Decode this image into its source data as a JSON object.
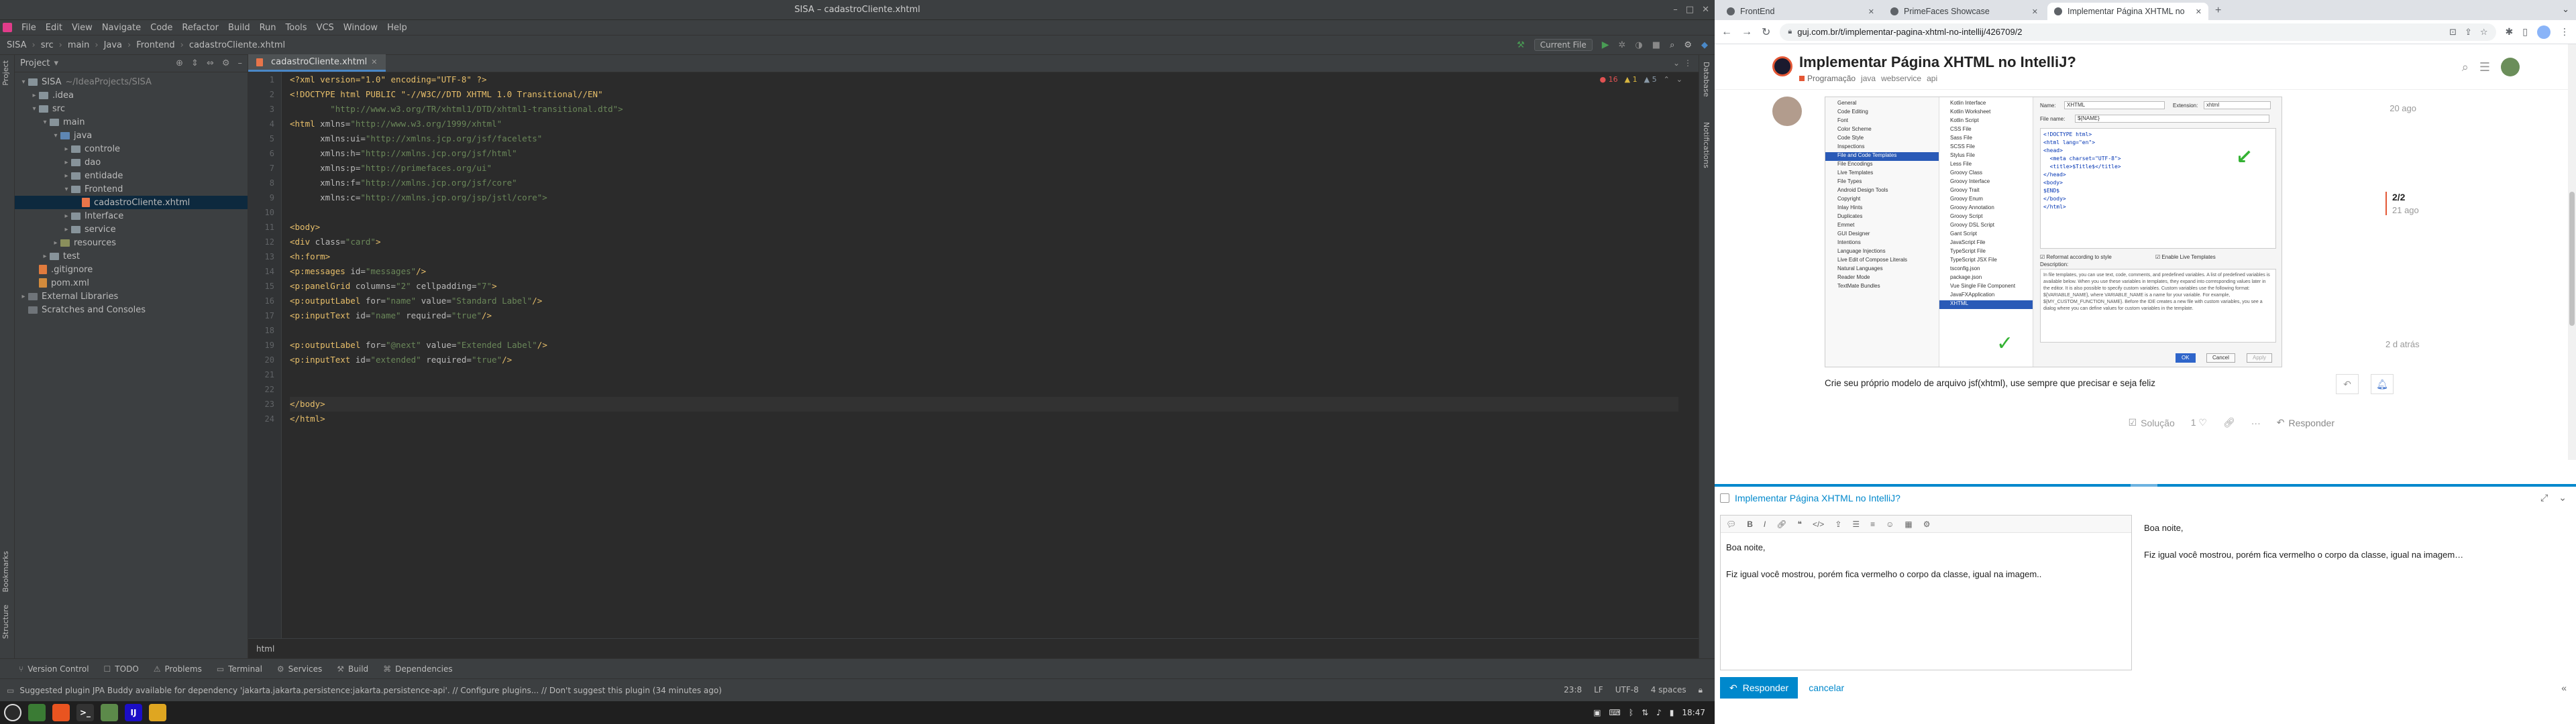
{
  "ide": {
    "window_title": "SISA – cadastroCliente.xhtml",
    "menu": [
      "File",
      "Edit",
      "View",
      "Navigate",
      "Code",
      "Refactor",
      "Build",
      "Run",
      "Tools",
      "VCS",
      "Window",
      "Help"
    ],
    "breadcrumb": [
      "SISA",
      "src",
      "main",
      "Java",
      "Frontend",
      "cadastroCliente.xhtml"
    ],
    "run_config": "Current File",
    "left_tabs": [
      "Project",
      "Bookmarks",
      "Structure"
    ],
    "right_tabs": [
      "Database",
      "Notifications"
    ],
    "project": {
      "title": "Project",
      "tree": [
        {
          "label": "SISA",
          "extra": "~/IdeaProjects/SISA",
          "depth": 0,
          "type": "folder",
          "open": true
        },
        {
          "label": ".idea",
          "depth": 1,
          "type": "folder",
          "open": false
        },
        {
          "label": "src",
          "depth": 1,
          "type": "folder",
          "open": true
        },
        {
          "label": "main",
          "depth": 2,
          "type": "folder",
          "open": true
        },
        {
          "label": "java",
          "depth": 3,
          "type": "src",
          "open": true
        },
        {
          "label": "controle",
          "depth": 4,
          "type": "folder",
          "open": false
        },
        {
          "label": "dao",
          "depth": 4,
          "type": "folder",
          "open": false
        },
        {
          "label": "entidade",
          "depth": 4,
          "type": "folder",
          "open": false
        },
        {
          "label": "Frontend",
          "depth": 4,
          "type": "folder",
          "open": true
        },
        {
          "label": "cadastroCliente.xhtml",
          "depth": 5,
          "type": "file",
          "selected": true
        },
        {
          "label": "Interface",
          "depth": 4,
          "type": "folder",
          "open": false
        },
        {
          "label": "service",
          "depth": 4,
          "type": "folder",
          "open": false
        },
        {
          "label": "resources",
          "depth": 3,
          "type": "res",
          "open": false
        },
        {
          "label": "test",
          "depth": 2,
          "type": "folder",
          "open": false
        },
        {
          "label": ".gitignore",
          "depth": 1,
          "type": "git"
        },
        {
          "label": "pom.xml",
          "depth": 1,
          "type": "xml"
        },
        {
          "label": "External Libraries",
          "depth": 0,
          "type": "lib",
          "open": false
        },
        {
          "label": "Scratches and Consoles",
          "depth": 0,
          "type": "lib"
        }
      ]
    },
    "editor": {
      "tab": "cadastroCliente.xhtml",
      "inspections": {
        "errors": "16",
        "warnings": "1",
        "weak": "5"
      },
      "footer": "html",
      "lines": [
        [
          [
            "<?xml version=\"1.0\" encoding=\"UTF-8\" ?>",
            "#e8bf6a"
          ]
        ],
        [
          [
            "<!DOCTYPE html PUBLIC \"-//W3C//DTD XHTML 1.0 Transitional//EN\"",
            "#e8bf6a"
          ]
        ],
        [
          [
            "        \"http://www.w3.org/TR/xhtml1/DTD/xhtml1-transitional.dtd\">",
            "#6a8759"
          ]
        ],
        [
          [
            "<html",
            "#e8bf6a"
          ],
          [
            " xmlns=",
            "#bababa"
          ],
          [
            "\"http://www.w3.org/1999/xhtml\"",
            "#6a8759"
          ]
        ],
        [
          [
            "      xmlns:ui=",
            "#bababa"
          ],
          [
            "\"http://xmlns.jcp.org/jsf/facelets\"",
            "#6a8759"
          ]
        ],
        [
          [
            "      xmlns:h=",
            "#bababa"
          ],
          [
            "\"http://xmlns.jcp.org/jsf/html\"",
            "#6a8759"
          ]
        ],
        [
          [
            "      xmlns:p=",
            "#bababa"
          ],
          [
            "\"http://primefaces.org/ui\"",
            "#6a8759"
          ]
        ],
        [
          [
            "      xmlns:f=",
            "#bababa"
          ],
          [
            "\"http://xmlns.jcp.org/jsf/core\"",
            "#6a8759"
          ]
        ],
        [
          [
            "      xmlns:c=",
            "#bababa"
          ],
          [
            "\"http://xmlns.jcp.org/jsp/jstl/core\">",
            "#6a8759"
          ]
        ],
        [
          [
            "",
            ""
          ]
        ],
        [
          [
            "<body>",
            "#e8bf6a"
          ]
        ],
        [
          [
            "<div ",
            "#e8bf6a"
          ],
          [
            "class=",
            "#bababa"
          ],
          [
            "\"card\"",
            "#6a8759"
          ],
          [
            ">",
            "#e8bf6a"
          ]
        ],
        [
          [
            "<h:form>",
            "#e8bf6a"
          ]
        ],
        [
          [
            "<p:messages ",
            "#e8bf6a"
          ],
          [
            "id=",
            "#bababa"
          ],
          [
            "\"messages\"",
            "#6a8759"
          ],
          [
            "/>",
            "#e8bf6a"
          ]
        ],
        [
          [
            "<p:panelGrid ",
            "#e8bf6a"
          ],
          [
            "columns=",
            "#bababa"
          ],
          [
            "\"2\" ",
            "#6a8759"
          ],
          [
            "cellpadding=",
            "#bababa"
          ],
          [
            "\"7\"",
            "#6a8759"
          ],
          [
            ">",
            "#e8bf6a"
          ]
        ],
        [
          [
            "<p:outputLabel ",
            "#e8bf6a"
          ],
          [
            "for=",
            "#bababa"
          ],
          [
            "\"name\" ",
            "#6a8759"
          ],
          [
            "value=",
            "#bababa"
          ],
          [
            "\"Standard Label\"",
            "#6a8759"
          ],
          [
            "/>",
            "#e8bf6a"
          ]
        ],
        [
          [
            "<p:inputText ",
            "#e8bf6a"
          ],
          [
            "id=",
            "#bababa"
          ],
          [
            "\"name\" ",
            "#6a8759"
          ],
          [
            "required=",
            "#bababa"
          ],
          [
            "\"true\"",
            "#6a8759"
          ],
          [
            "/>",
            "#e8bf6a"
          ]
        ],
        [
          [
            "",
            ""
          ]
        ],
        [
          [
            "<p:outputLabel ",
            "#e8bf6a"
          ],
          [
            "for=",
            "#bababa"
          ],
          [
            "\"@next\" ",
            "#6a8759"
          ],
          [
            "value=",
            "#bababa"
          ],
          [
            "\"Extended Label\"",
            "#6a8759"
          ],
          [
            "/>",
            "#e8bf6a"
          ]
        ],
        [
          [
            "<p:inputText ",
            "#e8bf6a"
          ],
          [
            "id=",
            "#bababa"
          ],
          [
            "\"extended\" ",
            "#6a8759"
          ],
          [
            "required=",
            "#bababa"
          ],
          [
            "\"true\"",
            "#6a8759"
          ],
          [
            "/>",
            "#e8bf6a"
          ]
        ],
        [
          [
            "",
            ""
          ]
        ],
        [
          [
            "",
            ""
          ]
        ],
        [
          [
            "</body>",
            "#e8bf6a"
          ]
        ],
        [
          [
            "</html>",
            "#e8bf6a"
          ]
        ]
      ]
    },
    "tool_tabs": [
      "Version Control",
      "TODO",
      "Problems",
      "Terminal",
      "Services",
      "Build",
      "Dependencies"
    ],
    "status_message": "Suggested plugin JPA Buddy available for dependency 'jakarta.jakarta.persistence:jakarta.persistence-api'. // Configure plugins... // Don't suggest this plugin (34 minutes ago)",
    "status_right": [
      "23:8",
      "LF",
      "UTF-8",
      "4 spaces"
    ]
  },
  "taskbar": {
    "apps": [
      {
        "name": "menu-app",
        "label": "",
        "color": "#2b2b2b"
      },
      {
        "name": "files-app",
        "label": "",
        "color": "#3a7b34"
      },
      {
        "name": "ubuntu-app",
        "label": "",
        "color": "#e95420"
      },
      {
        "name": "terminal-app",
        "label": ">_",
        "color": "#333"
      },
      {
        "name": "folder-app",
        "label": "",
        "color": "#5c8a4a"
      },
      {
        "name": "intellij-app",
        "label": "IJ",
        "color": "#1b0ec7"
      },
      {
        "name": "chrome-app",
        "label": "",
        "color": "#dfa621"
      }
    ],
    "clock": "18:47"
  },
  "browser": {
    "tabs": [
      {
        "title": "FrontEnd",
        "active": false
      },
      {
        "title": "PrimeFaces Showcase",
        "active": false
      },
      {
        "title": "Implementar Página XHTML no",
        "active": true
      }
    ],
    "url": "guj.com.br/t/implementar-pagina-xhtml-no-intellij/426709/2",
    "topic": {
      "title": "Implementar Página XHTML no IntelliJ?",
      "category": "Programação",
      "tags": [
        "java",
        "webservice",
        "api"
      ]
    },
    "post": {
      "date": "20 ago",
      "text": "Crie seu próprio modelo de arquivo jsf(xhtml), use sempre que precisar e seja feliz",
      "solution_label": "Solução",
      "likes": "1",
      "reply_label": "Responder"
    },
    "timeline": {
      "position": "2/2",
      "ago": "21 ago",
      "bottom": "2 d atrás"
    },
    "screenshot": {
      "settings_items": [
        "General",
        "Code Editing",
        "Font",
        "Color Scheme",
        "Code Style",
        "Inspections",
        "File and Code Templates",
        "File Encodings",
        "Live Templates",
        "File Types",
        "Android Design Tools",
        "Copyright",
        "Inlay Hints",
        "Duplicates",
        "Emmet",
        "GUI Designer",
        "Intentions",
        "Language Injections",
        "Live Edit of Compose Literals",
        "Natural Languages",
        "Reader Mode",
        "TextMate Bundles"
      ],
      "selected_setting": "File and Code Templates",
      "template_items": [
        "Kotlin Interface",
        "Kotlin Worksheet",
        "Kotlin Script",
        "CSS File",
        "Sass File",
        "SCSS File",
        "Stylus File",
        "Less File",
        "Groovy Class",
        "Groovy Interface",
        "Groovy Trait",
        "Groovy Enum",
        "Groovy Annotation",
        "Groovy Script",
        "Groovy DSL Script",
        "Gant Script",
        "JavaScript File",
        "TypeScript File",
        "TypeScript JSX File",
        "tsconfig.json",
        "package.json",
        "Vue Single File Component",
        "JavaFXApplication",
        "XHTML"
      ],
      "selected_template": "XHTML",
      "name_label": "Name:",
      "name_value": "XHTML",
      "ext_label": "Extension:",
      "ext_value": "xhtml",
      "filename_label": "File name:",
      "filename_value": "${NAME}",
      "code": [
        "<!DOCTYPE html>",
        "<html lang=\"en\">",
        "<head>",
        "  <meta charset=\"UTF-8\">",
        "  <title>$Title$</title>",
        "</head>",
        "<body>",
        "$END$",
        "</body>",
        "</html>"
      ],
      "reformat_label": "Reformat according to style",
      "enable_live_label": "Enable Live Templates",
      "description_label": "Description:",
      "description": "In file templates, you can use text, code, comments, and predefined variables. A list of predefined variables is available below. When you use these variables in templates, they expand into corresponding values later in the editor. It is also possible to specify custom variables. Custom variables use the following format: ${VARIABLE_NAME}, where VARIABLE_NAME is a name for your variable. For example, ${MY_CUSTOM_FUNCTION_NAME}. Before the IDE creates a new file with custom variables, you see a dialog where you can define values for custom variables in the template.",
      "ok": "OK",
      "cancel": "Cancel",
      "apply": "Apply"
    },
    "composer": {
      "reply_to": "Implementar Página XHTML no IntelliJ?",
      "greeting": "Boa noite,",
      "body": "Fiz igual você mostrou, porém fica vermelho o corpo da classe, igual na imagem..",
      "preview_body": "Fiz igual você mostrou, porém fica vermelho o corpo da classe, igual na imagem…",
      "reply_button": "Responder",
      "cancel": "cancelar"
    }
  }
}
